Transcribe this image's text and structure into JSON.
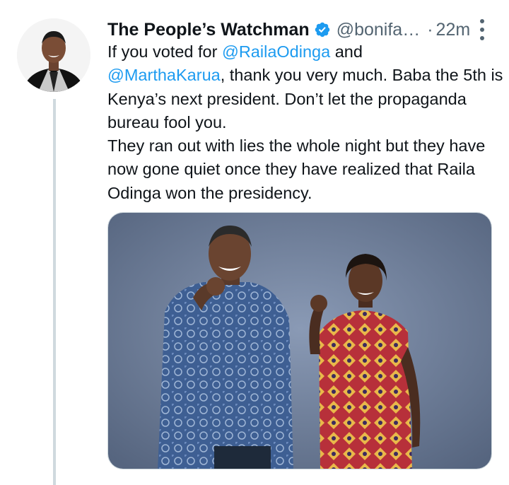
{
  "tweet": {
    "author": {
      "display_name": "The People’s Watchman",
      "handle": "@bonifa…",
      "verified": true,
      "avatar_icon": "profile-photo"
    },
    "separator": "·",
    "timestamp": "22m",
    "more_icon": "more-options-icon",
    "text": {
      "p1_before": "If you voted for ",
      "mention1": "@RailaOdinga",
      "p1_mid": " and ",
      "mention2": "@MarthaKarua",
      "p1_after": ", thank you very much. Baba the 5th is Kenya’s next president. Don’t let the propaganda bureau fool you.",
      "p2": "They ran out with lies the whole night but they have now gone quiet once they have realized that Raila Odinga won the presidency."
    },
    "media": {
      "type": "photo"
    }
  },
  "colors": {
    "text": "#0f1419",
    "secondary": "#536471",
    "link": "#1d9bf0",
    "thread_line": "#cfd9de",
    "verified_badge": "#1d9bf0"
  }
}
